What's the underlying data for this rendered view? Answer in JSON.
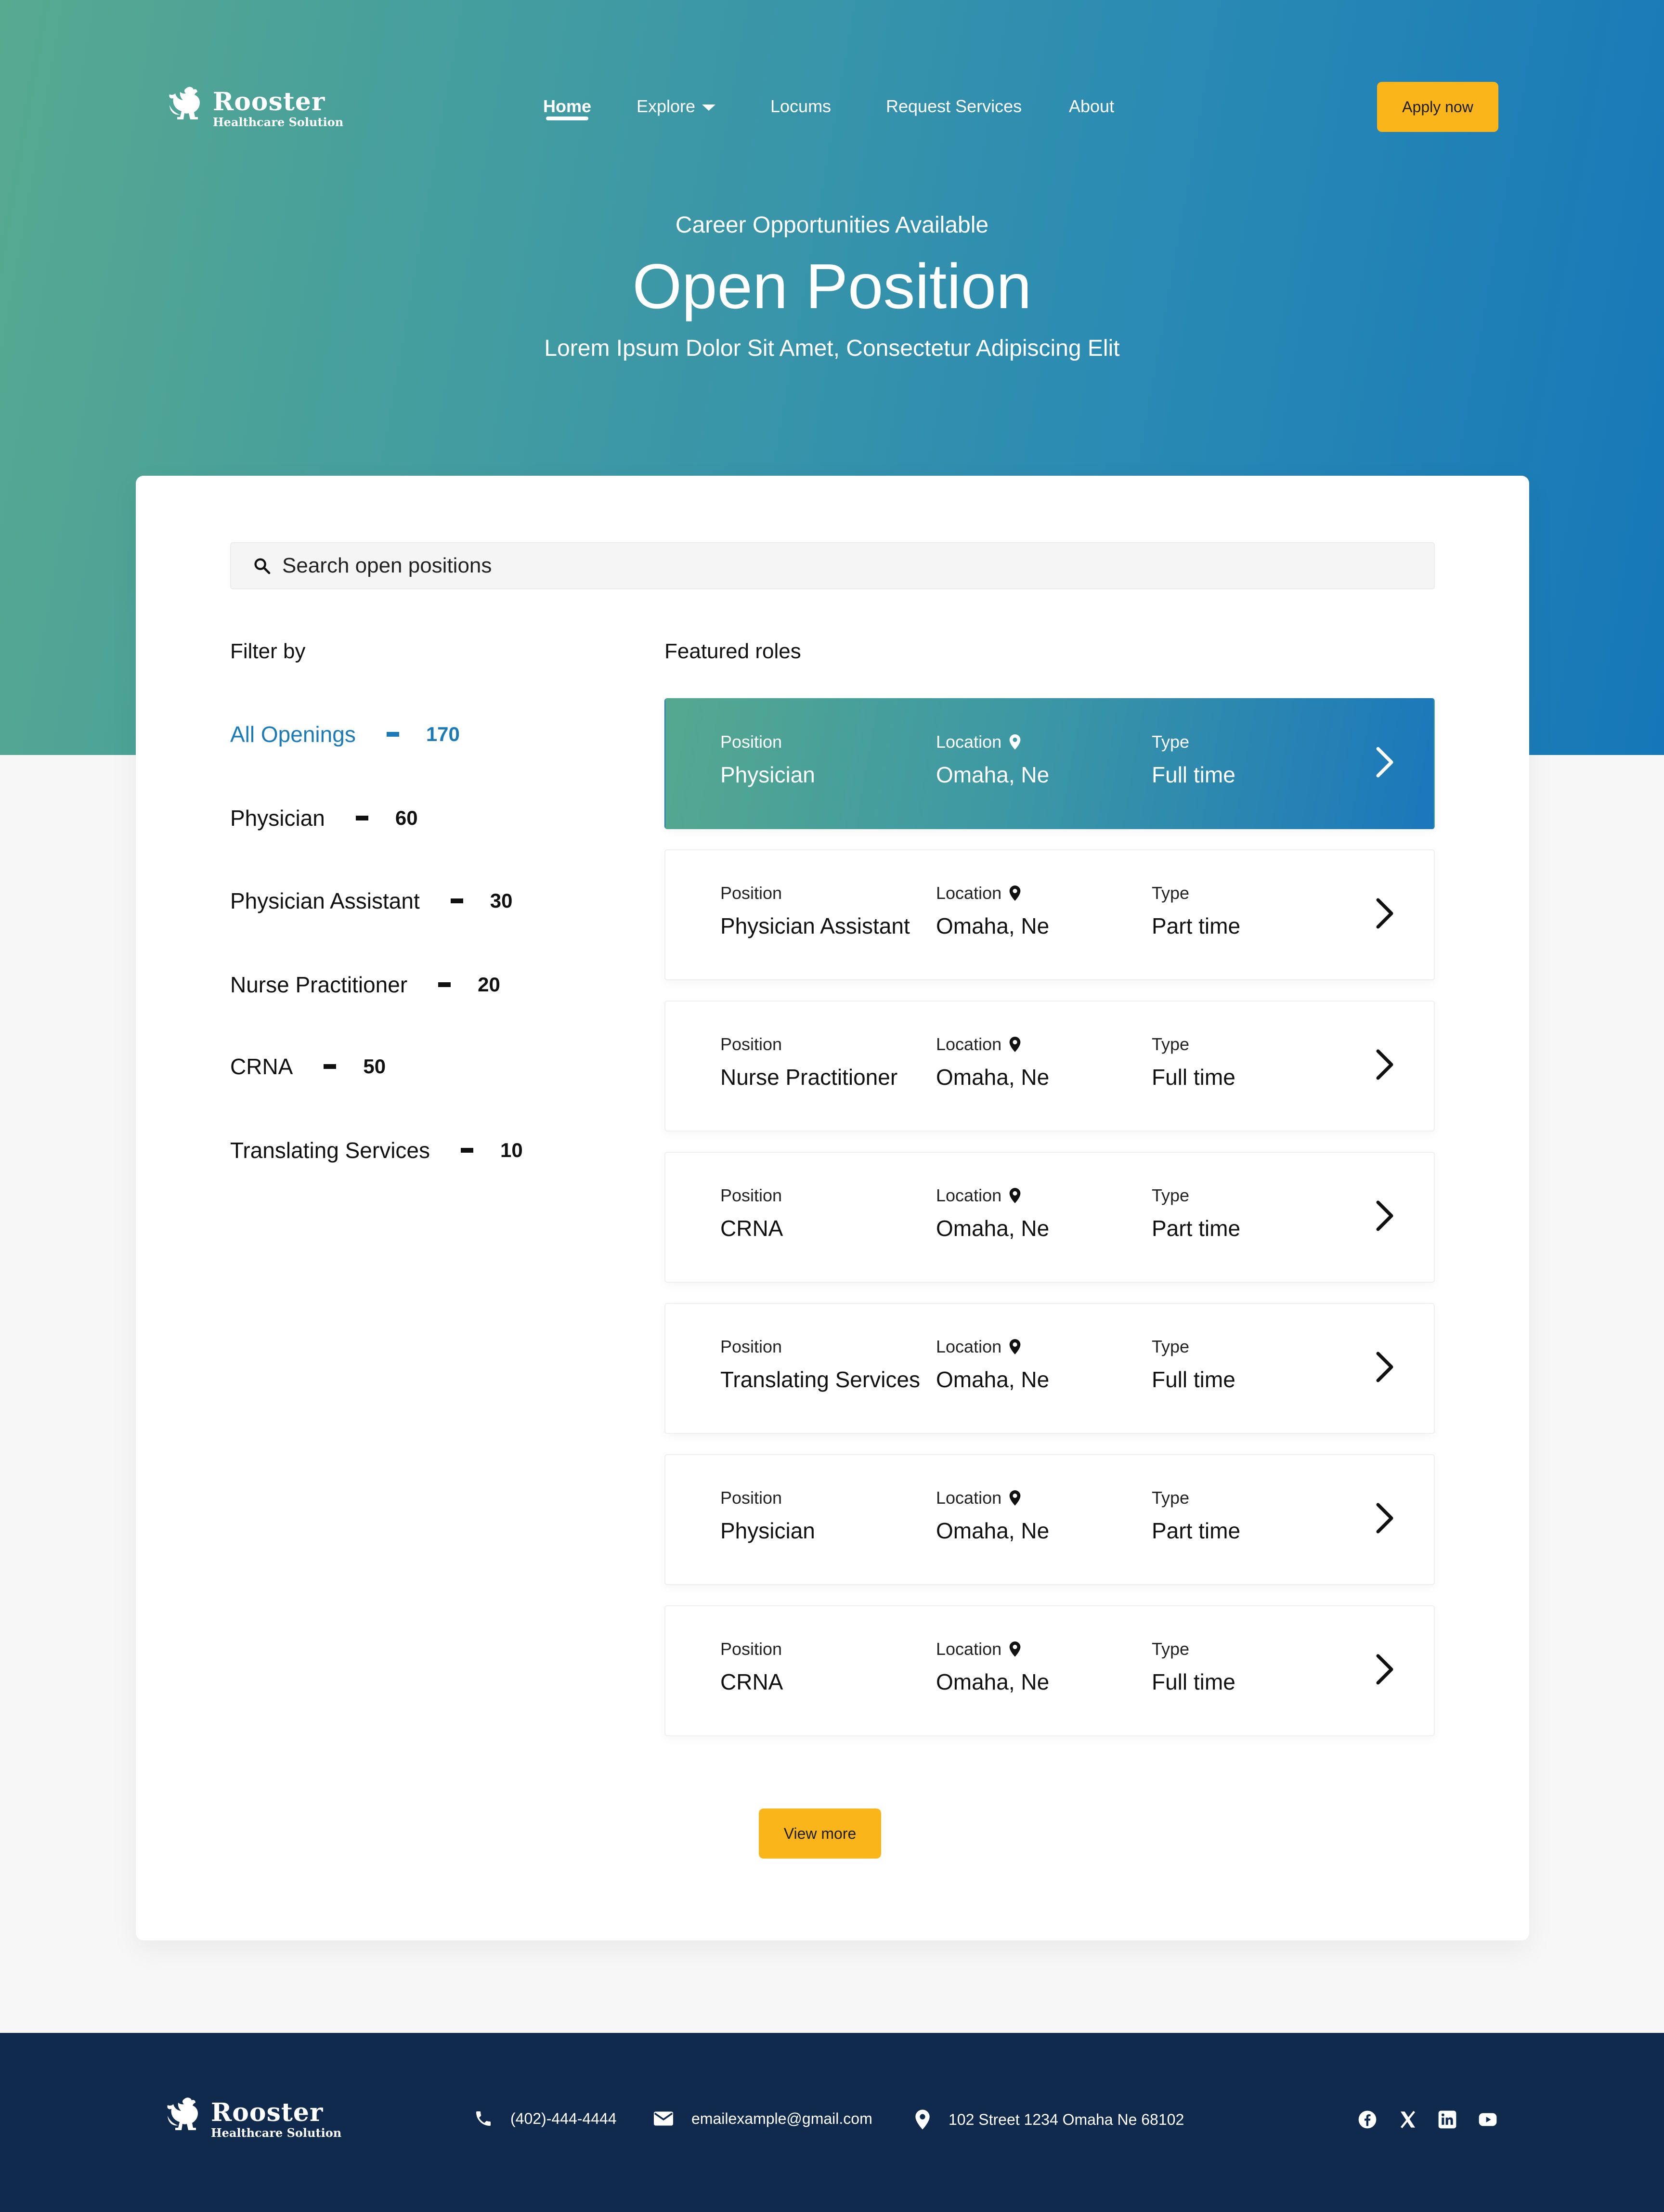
{
  "brand": {
    "name": "Rooster",
    "tagline": "Healthcare Solution"
  },
  "nav": {
    "items": [
      {
        "label": "Home",
        "active": true
      },
      {
        "label": "Explore",
        "has_dropdown": true
      },
      {
        "label": "Locums"
      },
      {
        "label": "Request Services"
      },
      {
        "label": "About"
      }
    ],
    "cta": "Apply now"
  },
  "hero": {
    "eyebrow": "Career Opportunities Available",
    "title": "Open Position",
    "subtitle": "Lorem Ipsum Dolor Sit Amet, Consectetur Adipiscing Elit"
  },
  "search": {
    "placeholder": "Search open positions"
  },
  "filters": {
    "heading": "Filter by",
    "items": [
      {
        "label": "All Openings",
        "count": "170",
        "active": true
      },
      {
        "label": "Physician",
        "count": "60"
      },
      {
        "label": "Physician Assistant",
        "count": "30"
      },
      {
        "label": "Nurse Practitioner",
        "count": "20"
      },
      {
        "label": "CRNA",
        "count": "50"
      },
      {
        "label": "Translating Services",
        "count": "10"
      }
    ]
  },
  "roles": {
    "heading": "Featured roles",
    "labels": {
      "position": "Position",
      "location": "Location",
      "type": "Type"
    },
    "items": [
      {
        "position": "Physician",
        "location": "Omaha, Ne",
        "type": "Full time",
        "highlighted": true
      },
      {
        "position": "Physician Assistant",
        "location": "Omaha, Ne",
        "type": "Part time"
      },
      {
        "position": "Nurse Practitioner",
        "location": "Omaha, Ne",
        "type": "Full time"
      },
      {
        "position": "CRNA",
        "location": "Omaha, Ne",
        "type": "Part time"
      },
      {
        "position": "Translating Services",
        "location": "Omaha, Ne",
        "type": "Full time"
      },
      {
        "position": "Physician",
        "location": "Omaha, Ne",
        "type": "Part time"
      },
      {
        "position": "CRNA",
        "location": "Omaha, Ne",
        "type": "Full time"
      }
    ],
    "view_more": "View more"
  },
  "footer": {
    "phone": "(402)-444-4444",
    "email": "emailexample@gmail.com",
    "address": "102 Street 1234 Omaha Ne 68102",
    "social": [
      "facebook-icon",
      "x-icon",
      "linkedin-icon",
      "youtube-icon"
    ]
  },
  "colors": {
    "accent_yellow": "#f9b51a",
    "accent_blue": "#1a7bb8",
    "hero_start": "#57a98f",
    "hero_end": "#1677b8",
    "footer_bg": "#0f2a4d"
  }
}
